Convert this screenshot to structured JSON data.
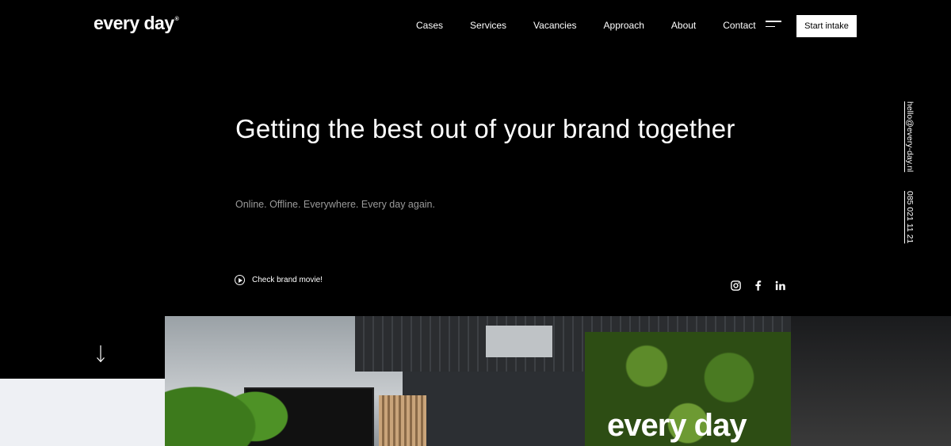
{
  "header": {
    "logo": "every day",
    "logo_mark": "®",
    "nav": [
      {
        "label": "Cases"
      },
      {
        "label": "Services"
      },
      {
        "label": "Vacancies"
      },
      {
        "label": "Approach"
      },
      {
        "label": "About"
      },
      {
        "label": "Contact"
      }
    ],
    "cta_label": "Start intake"
  },
  "hero": {
    "title": "Getting the best out of your brand together",
    "subtitle": "Online. Offline. Everywhere. Every day again.",
    "movie_link": "Check brand movie!"
  },
  "side_contact": {
    "email": "hello@every-day.nl",
    "phone": "085 021 11 21"
  },
  "socials": [
    "instagram-icon",
    "facebook-icon",
    "linkedin-icon"
  ],
  "photo": {
    "wordmark": "every day"
  },
  "colors": {
    "background": "#000000",
    "muted_text": "#9b9b9b",
    "light_block": "#eef0f4"
  }
}
